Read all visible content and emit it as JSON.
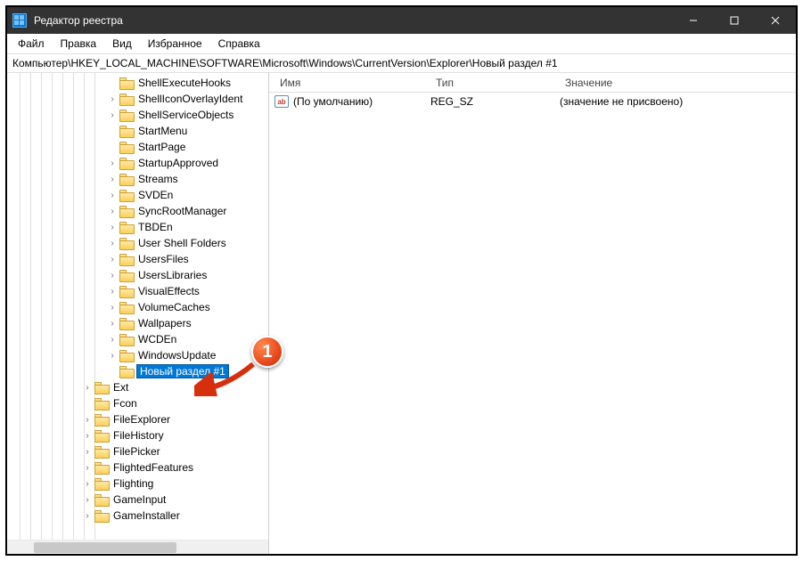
{
  "window": {
    "title": "Редактор реестра"
  },
  "menu": [
    "Файл",
    "Правка",
    "Вид",
    "Избранное",
    "Справка"
  ],
  "path": "Компьютер\\HKEY_LOCAL_MACHINE\\SOFTWARE\\Microsoft\\Windows\\CurrentVersion\\Explorer\\Новый раздел #1",
  "tree": {
    "vline_offsets": [
      14,
      26,
      38,
      50,
      62,
      74,
      86,
      98
    ],
    "group1": {
      "indent": 112,
      "items": [
        {
          "label": "ShellExecuteHooks",
          "exp": ""
        },
        {
          "label": "ShellIconOverlayIdent",
          "exp": "›"
        },
        {
          "label": "ShellServiceObjects",
          "exp": "›"
        },
        {
          "label": "StartMenu",
          "exp": ""
        },
        {
          "label": "StartPage",
          "exp": ""
        },
        {
          "label": "StartupApproved",
          "exp": "›"
        },
        {
          "label": "Streams",
          "exp": "›"
        },
        {
          "label": "SVDEn",
          "exp": "›"
        },
        {
          "label": "SyncRootManager",
          "exp": "›"
        },
        {
          "label": "TBDEn",
          "exp": "›"
        },
        {
          "label": "User Shell Folders",
          "exp": "›"
        },
        {
          "label": "UsersFiles",
          "exp": "›"
        },
        {
          "label": "UsersLibraries",
          "exp": "›"
        },
        {
          "label": "VisualEffects",
          "exp": "›"
        },
        {
          "label": "VolumeCaches",
          "exp": "›"
        },
        {
          "label": "Wallpapers",
          "exp": "›"
        },
        {
          "label": "WCDEn",
          "exp": "›"
        },
        {
          "label": "WindowsUpdate",
          "exp": "›"
        },
        {
          "label": "Новый раздел #1",
          "exp": "",
          "editing": true
        }
      ]
    },
    "group2": {
      "indent": 84,
      "items": [
        {
          "label": "Ext",
          "exp": "›"
        },
        {
          "label": "Fcon",
          "exp": ""
        },
        {
          "label": "FileExplorer",
          "exp": "›"
        },
        {
          "label": "FileHistory",
          "exp": "›"
        },
        {
          "label": "FilePicker",
          "exp": "›"
        },
        {
          "label": "FlightedFeatures",
          "exp": "›"
        },
        {
          "label": "Flighting",
          "exp": "›"
        },
        {
          "label": "GameInput",
          "exp": "›"
        },
        {
          "label": "GameInstaller",
          "exp": "›"
        }
      ]
    }
  },
  "list": {
    "columns": {
      "name": "Имя",
      "type": "Тип",
      "value": "Значение"
    },
    "rows": [
      {
        "icon": "ab",
        "name": "(По умолчанию)",
        "type": "REG_SZ",
        "value": "(значение не присвоено)"
      }
    ]
  },
  "callout": {
    "number": "1"
  }
}
